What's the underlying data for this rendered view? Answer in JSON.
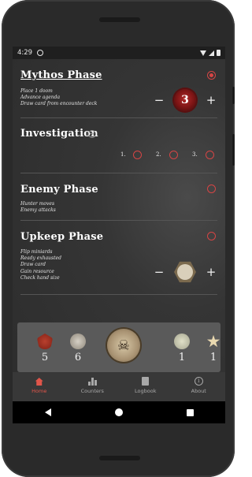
{
  "status_bar": {
    "time": "4:29"
  },
  "phases": {
    "mythos": {
      "title": "Mythos Phase",
      "steps": [
        "Place 1 doom",
        "Advance agenda",
        "Draw card from encounter deck"
      ],
      "selected": true,
      "doom_counter": {
        "value": "3",
        "minus": "−",
        "plus": "+"
      }
    },
    "investigation": {
      "title": "Investigation",
      "add_symbol": "+",
      "actions": [
        "1.",
        "2.",
        "3."
      ]
    },
    "enemy": {
      "title": "Enemy Phase",
      "steps": [
        "Hunter moves",
        "Enemy attacks"
      ]
    },
    "upkeep": {
      "title": "Upkeep Phase",
      "steps": [
        "Flip miniards",
        "Ready exhausted",
        "Draw card",
        "Gain resource",
        "Check hand size"
      ],
      "stepper": {
        "minus": "−",
        "plus": "+"
      }
    }
  },
  "resources": {
    "clues": {
      "icon": "clue-icon",
      "value": "5"
    },
    "doom": {
      "icon": "doom-token-icon",
      "value": "6"
    },
    "center": {
      "icon": "skull-icon",
      "glyph": "☠"
    },
    "elder_sign": {
      "icon": "elder-sign-icon",
      "value": "1"
    },
    "victory": {
      "icon": "star-icon",
      "glyph": "★",
      "value": "1"
    }
  },
  "bottom_nav": [
    {
      "label": "Home",
      "icon": "home-icon",
      "active": true
    },
    {
      "label": "Counters",
      "icon": "bar-chart-icon",
      "active": false
    },
    {
      "label": "Logbook",
      "icon": "book-icon",
      "active": false
    },
    {
      "label": "About",
      "icon": "info-icon",
      "active": false
    }
  ],
  "info_glyph": "i",
  "colors": {
    "accent": "#d64545",
    "background": "#2f2f2f",
    "panel": "#5a5a5a"
  }
}
